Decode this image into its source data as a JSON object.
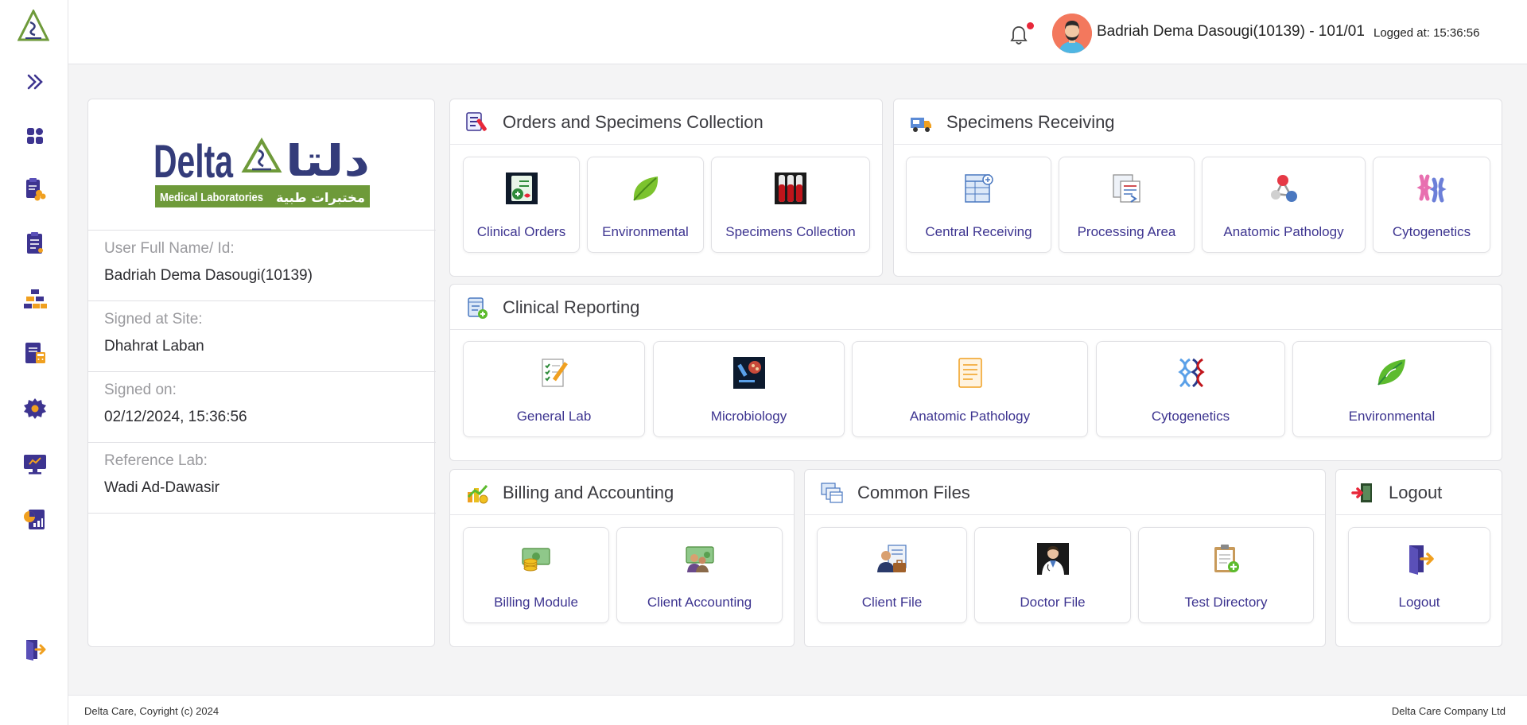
{
  "topbar": {
    "user_name": "Badriah Dema Dasougi(10139) - 101/01",
    "logged_at": "Logged at: 15:36:56",
    "notification_color": "#e8283a"
  },
  "sidebar": {
    "items": [
      {
        "name": "expand",
        "icon": "double-chevron-right-icon"
      },
      {
        "name": "dashboard",
        "icon": "grid-icon"
      },
      {
        "name": "orders",
        "icon": "clipboard-hex-icon"
      },
      {
        "name": "reports",
        "icon": "document-icon"
      },
      {
        "name": "hierarchy",
        "icon": "stack-icon"
      },
      {
        "name": "billing",
        "icon": "calculator-doc-icon"
      },
      {
        "name": "settings",
        "icon": "gear-icon"
      },
      {
        "name": "monitor",
        "icon": "monitor-icon"
      },
      {
        "name": "statistics",
        "icon": "chart-doc-icon"
      },
      {
        "name": "logout",
        "icon": "logout-icon"
      }
    ]
  },
  "info": {
    "logo_latin": "Delta",
    "logo_arabic": "دلتا",
    "logo_sub_latin": "Medical Laboratories",
    "logo_sub_arabic": "مختبرات طبية",
    "fields": [
      {
        "label": "User Full Name/ Id:",
        "value": "Badriah Dema Dasougi(10139)"
      },
      {
        "label": "Signed at Site:",
        "value": "Dhahrat Laban"
      },
      {
        "label": "Signed on:",
        "value": "02/12/2024, 15:36:56"
      },
      {
        "label": "Reference Lab:",
        "value": "Wadi Ad-Dawasir"
      }
    ]
  },
  "panels": {
    "orders": {
      "title": "Orders and Specimens Collection",
      "tiles": [
        "Clinical Orders",
        "Environmental",
        "Specimens Collection"
      ]
    },
    "receiving": {
      "title": "Specimens Receiving",
      "tiles": [
        "Central Receiving",
        "Processing Area",
        "Anatomic Pathology",
        "Cytogenetics"
      ]
    },
    "reporting": {
      "title": "Clinical Reporting",
      "tiles": [
        "General Lab",
        "Microbiology",
        "Anatomic Pathology",
        "Cytogenetics",
        "Environmental"
      ]
    },
    "billing": {
      "title": "Billing and Accounting",
      "tiles": [
        "Billing Module",
        "Client Accounting"
      ]
    },
    "common": {
      "title": "Common Files",
      "tiles": [
        "Client File",
        "Doctor File",
        "Test Directory"
      ]
    },
    "logout": {
      "title": "Logout",
      "tiles": [
        "Logout"
      ]
    }
  },
  "footer": {
    "left": "Delta Care, Coyright (c) 2024",
    "right": "Delta Care Company Ltd"
  },
  "colors": {
    "accent": "#3d3490",
    "brand_green": "#6e9a3a",
    "brand_navy": "#343c7a"
  }
}
